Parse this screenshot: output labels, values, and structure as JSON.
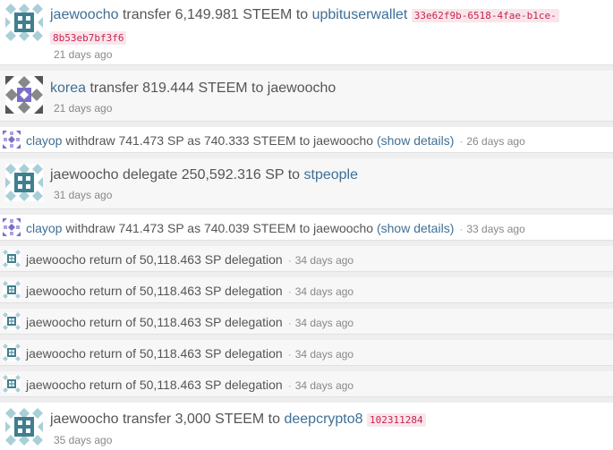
{
  "feed": {
    "items": [
      {
        "user": "jaewoocho",
        "action": " transfer 6,149.981 STEEM to ",
        "target": "upbituserwallet",
        "memo_line1": "33e62f9b-6518-4fae-b1ce-",
        "memo_line2": "8b53eb7bf3f6",
        "time": "21 days ago"
      },
      {
        "user": "korea",
        "action": " transfer 819.444 STEEM to ",
        "target": "jaewoocho",
        "time": "21 days ago"
      },
      {
        "user": "clayop",
        "action": " withdraw 741.473 SP as 740.333 STEEM to ",
        "target": "jaewoocho",
        "details": "(show details)",
        "sep": "·",
        "time": "26 days ago"
      },
      {
        "user": "jaewoocho",
        "action": " delegate 250,592.316 SP to ",
        "target": "stpeople",
        "time": "31 days ago"
      },
      {
        "user": "clayop",
        "action": " withdraw 741.473 SP as 740.039 STEEM to ",
        "target": "jaewoocho",
        "details": "(show details)",
        "sep": "·",
        "time": "33 days ago"
      },
      {
        "user": "jaewoocho",
        "action": " return of 50,118.463 SP delegation",
        "sep": "·",
        "time": "34 days ago"
      },
      {
        "user": "jaewoocho",
        "action": " return of 50,118.463 SP delegation",
        "sep": "·",
        "time": "34 days ago"
      },
      {
        "user": "jaewoocho",
        "action": " return of 50,118.463 SP delegation",
        "sep": "·",
        "time": "34 days ago"
      },
      {
        "user": "jaewoocho",
        "action": " return of 50,118.463 SP delegation",
        "sep": "·",
        "time": "34 days ago"
      },
      {
        "user": "jaewoocho",
        "action": " return of 50,118.463 SP delegation",
        "sep": "·",
        "time": "34 days ago"
      },
      {
        "user": "jaewoocho",
        "action": " transfer 3,000 STEEM to ",
        "target": "deepcrypto8",
        "memo_line1": "102311284",
        "time": "35 days ago"
      }
    ]
  },
  "colors": {
    "link": "#3f6f95",
    "text": "#555555",
    "memo_text": "#c7254e",
    "memo_bg": "#f9e6ec",
    "avatar_teal": "#3f7f8f",
    "avatar_light": "#a9cfd8",
    "avatar_purple": "#7a6fc8",
    "avatar_dark": "#555555"
  },
  "icons": {
    "jaewoocho": "identicon-teal-avatar",
    "korea": "identicon-purple-diamond-avatar",
    "clayop": "identicon-purple-pattern-avatar"
  }
}
